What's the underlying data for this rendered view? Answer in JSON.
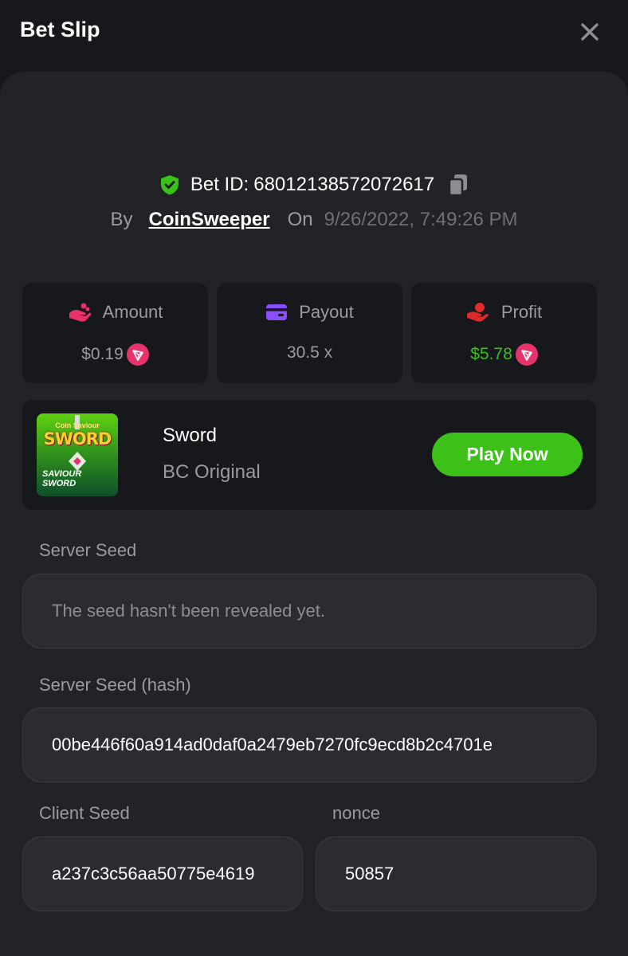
{
  "header": {
    "title": "Bet Slip"
  },
  "bet": {
    "id_label": "Bet ID:",
    "id_value": "68012138572072617",
    "by_label": "By",
    "username": "CoinSweeper",
    "on_label": "On",
    "datetime": "9/26/2022, 7:49:26 PM"
  },
  "stats": {
    "amount": {
      "label": "Amount",
      "value": "$0.19",
      "icon": "coins-hand-icon",
      "color": "#e8326b"
    },
    "payout": {
      "label": "Payout",
      "value": "30.5 x",
      "icon": "card-icon",
      "color": "#8a4dff"
    },
    "profit": {
      "label": "Profit",
      "value": "$5.78",
      "icon": "profit-hand-icon",
      "color": "#e02b2b",
      "value_color": "#3bc117"
    }
  },
  "game": {
    "thumb_small": "Coin Saviour",
    "thumb_title": "SWORD",
    "thumb_sub_1": "SAVIOUR",
    "thumb_sub_2": "SWORD",
    "name": "Sword",
    "provider": "BC Original",
    "play_label": "Play Now"
  },
  "fields": {
    "server_seed_label": "Server Seed",
    "server_seed_value": "The seed hasn't been revealed yet.",
    "server_hash_label": "Server Seed (hash)",
    "server_hash_value": "00be446f60a914ad0daf0a2479eb7270fc9ecd8b2c4701e",
    "client_seed_label": "Client Seed",
    "client_seed_value": "a237c3c56aa50775e4619",
    "nonce_label": "nonce",
    "nonce_value": "50857"
  },
  "colors": {
    "accent_green": "#3bc117",
    "shield_green": "#3bc117",
    "trx_red": "#e8326b"
  }
}
